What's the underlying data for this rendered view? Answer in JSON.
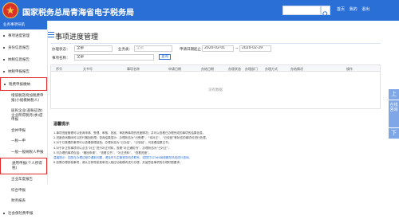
{
  "header": {
    "brand": "国家税务总局青海省电子税务局",
    "links": [
      "首页",
      "我的",
      "退出"
    ]
  },
  "sidebar": {
    "head": "业务事项导航",
    "items": [
      {
        "label": "事项进度管理",
        "level": "top"
      },
      {
        "label": "身份信息报告",
        "level": "top"
      },
      {
        "label": "纳税信息报告",
        "level": "top"
      },
      {
        "label": "纳税申报报告",
        "level": "top"
      },
      {
        "label": "税费申报缴纳",
        "level": "top",
        "highlight": true
      },
      {
        "label": "增值税及附加税费申报(小规模纳税人)",
        "level": "sub"
      },
      {
        "label": "居民企业(查账征收)企业所得税月(季)度申报",
        "level": "sub"
      },
      {
        "label": "合并申报",
        "level": "sub"
      },
      {
        "label": "一税一申",
        "level": "sub"
      },
      {
        "label": "一般一般纳税人申报",
        "level": "sub"
      },
      {
        "label": "通用申报(个人所得税)",
        "level": "sub",
        "highlight": true
      },
      {
        "label": "企业年度报告",
        "level": "sub"
      },
      {
        "label": "综合申报",
        "level": "sub"
      },
      {
        "label": "财务报表",
        "level": "sub"
      },
      {
        "label": "社会保险费申报",
        "level": "top"
      }
    ]
  },
  "main": {
    "title": "事项进度管理",
    "filters": {
      "business_type_label": "办理状态：",
      "business_type_value": "全部",
      "category_label": "业务类：",
      "category_value": "全部",
      "date_label": "申请日期起止：",
      "date_from": "2020-02-01",
      "date_sep": "~",
      "date_to": "2020-02-29",
      "matter_label": "事项名称：",
      "matter_value": "全部",
      "query_button": "查询"
    },
    "table": {
      "columns": [
        "序号",
        "文书号",
        "事项名称",
        "申请日期",
        "办结日期",
        "办理状态",
        "办理部门",
        "办理方式",
        "办结情况",
        "操作"
      ],
      "empty_text": "没有数据"
    },
    "tips": {
      "title": "温馨提示",
      "lines": [
        "1.事项进度管理可以查询申请、受理、审核、批准、审批等事项的进度情况；并可以查看已办理完成的事项的结果信息。",
        "2.进度查询期间可以进行撤回处理；查询结果显示：办理状态为“已受理”，“待补正”，“已驳回”等状态的事项可进行处理。",
        "3.对于已受理的事项可以查看受理回执；办理状态为“已办结”，“已驳回”，可查看结果文书。",
        "4.对于补正的事项可以点击“补正”进行补正材料，查看“补正通知书”，办理状态为“已补正”。",
        "5.可办理的事项包括：“撤回申请”、“查看文书”、“补正资料”、“查看进度”。",
        "温馨提示：如您在办理过程中遇到问题，请及时与主管税务机关联系，或拨打12366纳税服务热线进行咨询。",
        "6.如需办理其他事项，请从左侧导航菜单进入相应功能模块进行办理，并留意各事项的办理时限要求。"
      ]
    }
  },
  "float_bar": [
    "上",
    "在线咨询",
    "下"
  ]
}
